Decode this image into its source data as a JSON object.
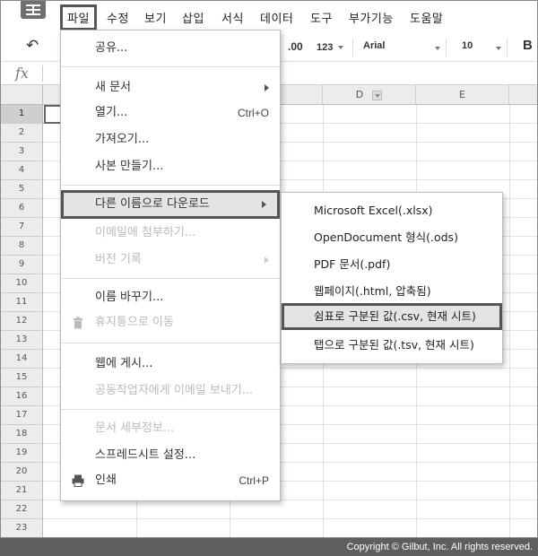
{
  "menubar": {
    "items": [
      "파일",
      "수정",
      "보기",
      "삽입",
      "서식",
      "데이터",
      "도구",
      "부가기능",
      "도움말"
    ]
  },
  "toolbar": {
    "decimal": ".00",
    "number_format": "123",
    "font": "Arial",
    "font_size": "10",
    "bold": "B"
  },
  "formula": {
    "fx": "fx"
  },
  "grid": {
    "columns": [
      "D",
      "E"
    ],
    "rows": [
      "1",
      "2",
      "3",
      "4",
      "5",
      "6",
      "7",
      "8",
      "9",
      "10",
      "11",
      "12",
      "13",
      "14",
      "15",
      "16",
      "17",
      "18",
      "19",
      "20",
      "21",
      "22",
      "23"
    ]
  },
  "file_menu": {
    "items": [
      {
        "label": "공유...",
        "disabled": false
      },
      {
        "label": "새 문서",
        "disabled": false,
        "submenu": true
      },
      {
        "label": "열기...",
        "disabled": false,
        "shortcut": "Ctrl+O"
      },
      {
        "label": "가져오기...",
        "disabled": false
      },
      {
        "label": "사본 만들기...",
        "disabled": false
      },
      {
        "label": "다른 이름으로 다운로드",
        "disabled": false,
        "submenu": true,
        "highlight": true
      },
      {
        "label": "이메일에 첨부하기...",
        "disabled": true
      },
      {
        "label": "버전 기록",
        "disabled": true,
        "submenu": true
      },
      {
        "label": "이름 바꾸기...",
        "disabled": false
      },
      {
        "label": "휴지통으로 이동",
        "disabled": true,
        "icon": "trash-icon"
      },
      {
        "label": "웹에 게시...",
        "disabled": false
      },
      {
        "label": "공동작업자에게 이메일 보내기...",
        "disabled": true
      },
      {
        "label": "문서 세부정보...",
        "disabled": true
      },
      {
        "label": "스프레드시트 설정...",
        "disabled": false
      },
      {
        "label": "인쇄",
        "disabled": false,
        "shortcut": "Ctrl+P",
        "icon": "printer-icon"
      }
    ]
  },
  "download_submenu": {
    "items": [
      {
        "label": "Microsoft Excel(.xlsx)"
      },
      {
        "label": "OpenDocument 형식(.ods)"
      },
      {
        "label": "PDF 문서(.pdf)"
      },
      {
        "label": "웹페이지(.html, 압축됨)"
      },
      {
        "label": "쉼표로 구분된 값(.csv, 현재 시트)",
        "highlight": true
      },
      {
        "label": "탭으로 구분된 값(.tsv, 현재 시트)"
      }
    ]
  },
  "footer": {
    "copyright": "Copyright © Gilbut, Inc. All rights reserved."
  },
  "colors": {
    "highlight_border": "#555555",
    "menu_bg": "#ffffff",
    "disabled_text": "#bbbbbb"
  }
}
